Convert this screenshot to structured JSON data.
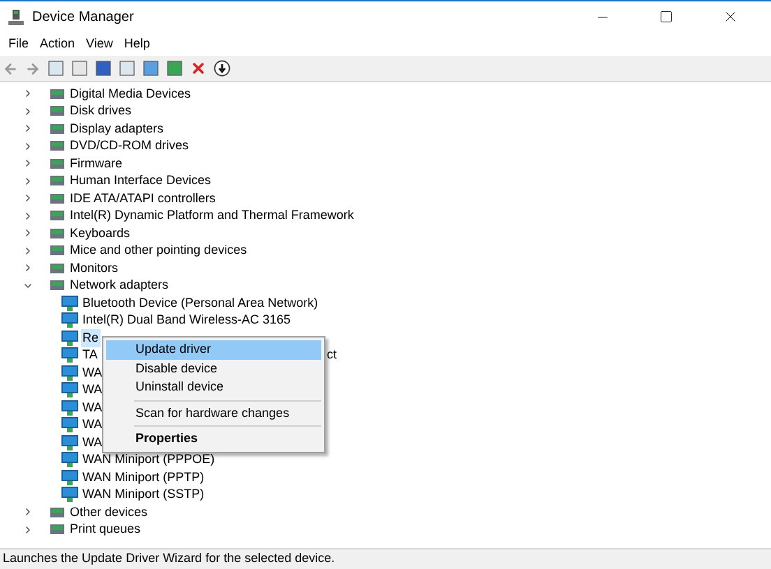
{
  "window": {
    "title": "Device Manager"
  },
  "menu_bar": [
    "File",
    "Action",
    "View",
    "Help"
  ],
  "tree": [
    {
      "label": "Digital Media Devices",
      "expanded": false
    },
    {
      "label": "Disk drives",
      "expanded": false
    },
    {
      "label": "Display adapters",
      "expanded": false
    },
    {
      "label": "DVD/CD-ROM drives",
      "expanded": false
    },
    {
      "label": "Firmware",
      "expanded": false
    },
    {
      "label": "Human Interface Devices",
      "expanded": false
    },
    {
      "label": "IDE ATA/ATAPI controllers",
      "expanded": false
    },
    {
      "label": "Intel(R) Dynamic Platform and Thermal Framework",
      "expanded": false
    },
    {
      "label": "Keyboards",
      "expanded": false
    },
    {
      "label": "Mice and other pointing devices",
      "expanded": false
    },
    {
      "label": "Monitors",
      "expanded": false
    },
    {
      "label": "Network adapters",
      "expanded": true,
      "children": [
        {
          "label": "Bluetooth Device (Personal Area Network)",
          "selected": false
        },
        {
          "label": "Intel(R) Dual Band Wireless-AC 3165",
          "selected": false
        },
        {
          "label": "Re",
          "selected": true
        },
        {
          "label": "TA",
          "tail": "ct",
          "selected": false
        },
        {
          "label": "WA",
          "selected": false
        },
        {
          "label": "WA",
          "selected": false
        },
        {
          "label": "WA",
          "selected": false
        },
        {
          "label": "WA",
          "selected": false
        },
        {
          "label": "WA",
          "selected": false
        },
        {
          "label": "WAN Miniport (PPPOE)",
          "selected": false
        },
        {
          "label": "WAN Miniport (PPTP)",
          "selected": false
        },
        {
          "label": "WAN Miniport (SSTP)",
          "selected": false
        }
      ]
    },
    {
      "label": "Other devices",
      "expanded": false
    },
    {
      "label": "Print queues",
      "expanded": false
    }
  ],
  "context_menu": {
    "items": [
      {
        "kind": "item",
        "label": "Update driver",
        "selected": true
      },
      {
        "kind": "item",
        "label": "Disable device",
        "selected": false
      },
      {
        "kind": "item",
        "label": "Uninstall device",
        "selected": false
      },
      {
        "kind": "separator"
      },
      {
        "kind": "item",
        "label": "Scan for hardware changes",
        "selected": false
      },
      {
        "kind": "separator"
      },
      {
        "kind": "bold",
        "label": "Properties",
        "selected": false
      }
    ]
  },
  "status_bar": "Launches the Update Driver Wizard for the selected device."
}
